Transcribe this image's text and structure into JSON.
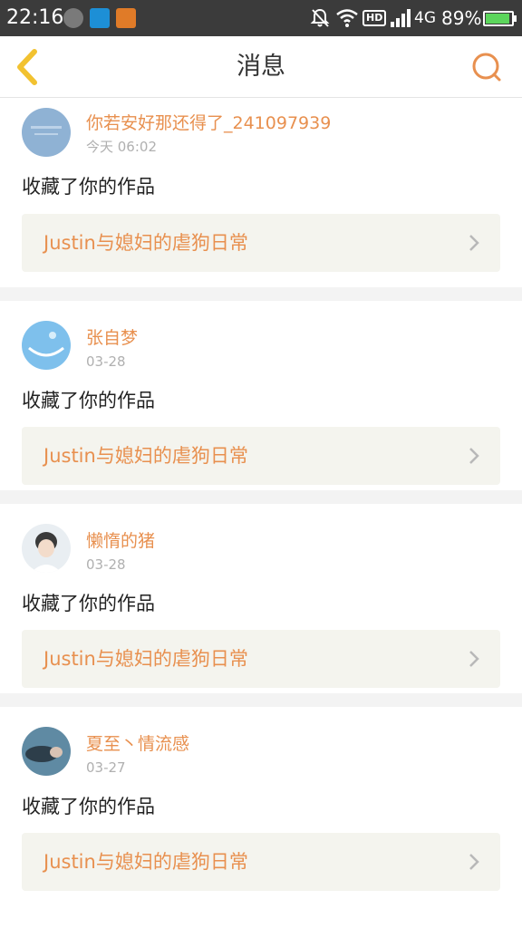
{
  "status_bar": {
    "time": "22:16",
    "hd": "HD",
    "network": "4G",
    "battery": "89%",
    "battery_level": 0.89
  },
  "nav": {
    "title": "消息",
    "back_icon": "chevron-left-icon",
    "search_icon": "search-icon"
  },
  "colors": {
    "accent": "#e8904f",
    "back_icon": "#f2c230",
    "card_bg": "#f4f4ee"
  },
  "messages": [
    {
      "user": "你若安好那还得了_241097939",
      "time": "今天 06:02",
      "action": "收藏了你的作品",
      "work": "Justin与媳妇的虐狗日常"
    },
    {
      "user": "张自梦",
      "time": "03-28",
      "action": "收藏了你的作品",
      "work": "Justin与媳妇的虐狗日常"
    },
    {
      "user": "懒惰的猪",
      "time": "03-28",
      "action": "收藏了你的作品",
      "work": "Justin与媳妇的虐狗日常"
    },
    {
      "user": "夏至丶情流感",
      "time": "03-27",
      "action": "收藏了你的作品",
      "work": "Justin与媳妇的虐狗日常"
    }
  ]
}
